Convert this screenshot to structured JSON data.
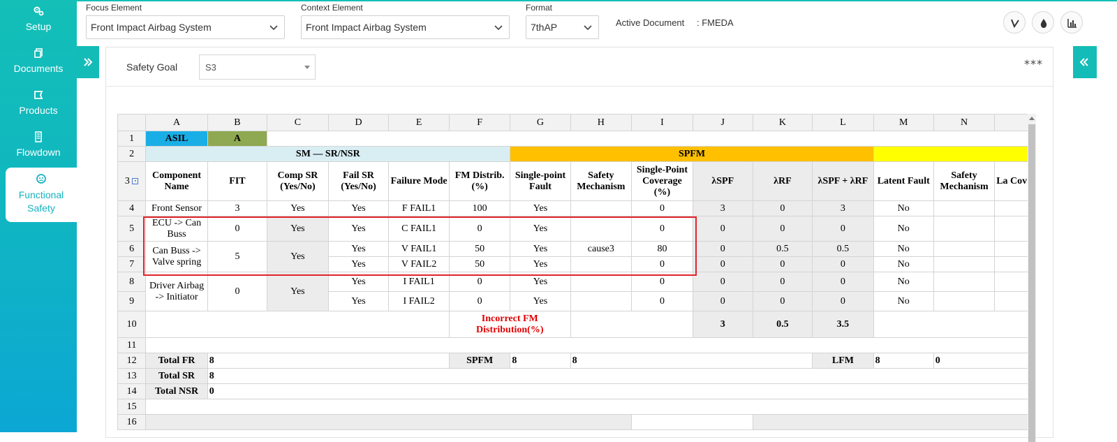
{
  "sidebar": {
    "items": [
      {
        "label": "Setup",
        "icon": "gears-icon"
      },
      {
        "label": "Documents",
        "icon": "documents-icon"
      },
      {
        "label": "Products",
        "icon": "products-icon"
      },
      {
        "label": "Flowdown",
        "icon": "flowdown-icon"
      },
      {
        "label": "Functional Safety",
        "icon": "functional-safety-icon",
        "active": true
      }
    ]
  },
  "topbar": {
    "focus_label": "Focus Element",
    "focus_value": "Front Impact Airbag System",
    "context_label": "Context Element",
    "context_value": "Front Impact Airbag System",
    "format_label": "Format",
    "format_value": "7thAP",
    "active_doc_label": "Active Document",
    "active_doc_value": ": FMEDA"
  },
  "safety_goal": {
    "label": "Safety Goal",
    "value": "S3",
    "more": "***"
  },
  "sheet": {
    "columns": [
      "A",
      "B",
      "C",
      "D",
      "E",
      "F",
      "G",
      "H",
      "I",
      "J",
      "K",
      "L",
      "M",
      "N",
      ""
    ],
    "row_numbers": [
      "1",
      "2",
      "3",
      "4",
      "5",
      "6",
      "7",
      "8",
      "9",
      "10",
      "11",
      "12",
      "13",
      "14",
      "15",
      "16"
    ],
    "row1": {
      "asil": "ASIL",
      "asil_value": "A"
    },
    "row2": {
      "sm": "SM — SR/NSR",
      "spfm": "SPFM"
    },
    "headers": {
      "component_name": "Component Name",
      "fit": "FIT",
      "comp_sr": "Comp SR (Yes/No)",
      "fail_sr": "Fail SR (Yes/No)",
      "failure_mode": "Failure Mode",
      "fm_distrib": "FM Distrib. (%)",
      "single_point_fault": "Single-point Fault",
      "safety_mechanism": "Safety Mechanism",
      "spc": "Single-Point Coverage (%)",
      "lspf": "λSPF",
      "lrf": "λRF",
      "lspf_lrf": "λSPF + λRF",
      "latent_fault": "Latent Fault",
      "safety_mechanism2": "Safety Mechanism",
      "partial": "La Cov"
    },
    "rows": {
      "r4": {
        "comp": "Front Sensor",
        "fit": "3",
        "compsr": "Yes",
        "failsr": "Yes",
        "fm": "F FAIL1",
        "dist": "100",
        "spf": "Yes",
        "sm": "",
        "spc": "0",
        "lspf": "3",
        "lrf": "0",
        "sum": "3",
        "lat": "No"
      },
      "r5": {
        "comp": "ECU -> Can Buss",
        "fit": "0",
        "compsr": "Yes",
        "failsr": "Yes",
        "fm": "C FAIL1",
        "dist": "0",
        "spf": "Yes",
        "sm": "",
        "spc": "0",
        "lspf": "0",
        "lrf": "0",
        "sum": "0",
        "lat": "No"
      },
      "r6": {
        "comp": "Can Buss -> Valve spring",
        "fit": "5",
        "compsr": "Yes",
        "failsr": "Yes",
        "fm": "V FAIL1",
        "dist": "50",
        "spf": "Yes",
        "sm": "cause3",
        "spc": "80",
        "lspf": "0",
        "lrf": "0.5",
        "sum": "0.5",
        "lat": "No"
      },
      "r7": {
        "failsr": "Yes",
        "fm": "V FAIL2",
        "dist": "50",
        "spf": "Yes",
        "sm": "",
        "spc": "0",
        "lspf": "0",
        "lrf": "0",
        "sum": "0",
        "lat": "No"
      },
      "r8": {
        "comp": "Driver Airbag -> Initiator",
        "fit": "0",
        "compsr": "Yes",
        "failsr": "Yes",
        "fm": "I FAIL1",
        "dist": "0",
        "spf": "Yes",
        "sm": "",
        "spc": "0",
        "lspf": "0",
        "lrf": "0",
        "sum": "0",
        "lat": "No"
      },
      "r9": {
        "failsr": "Yes",
        "fm": "I FAIL2",
        "dist": "0",
        "spf": "Yes",
        "sm": "",
        "spc": "0",
        "lspf": "0",
        "lrf": "0",
        "sum": "0",
        "lat": "No"
      },
      "r10": {
        "warning": "Incorrect FM Distribution(%)",
        "lspf": "3",
        "lrf": "0.5",
        "sum": "3.5"
      }
    },
    "totals": {
      "total_fr_label": "Total FR",
      "total_fr": "8",
      "spfm_label": "SPFM",
      "spfm_g": "8",
      "spfm_h": "8",
      "lfm_label": "LFM",
      "lfm_m": "8",
      "lfm_n": "0",
      "total_sr_label": "Total SR",
      "total_sr": "8",
      "total_nsr_label": "Total NSR",
      "total_nsr": "0"
    }
  }
}
